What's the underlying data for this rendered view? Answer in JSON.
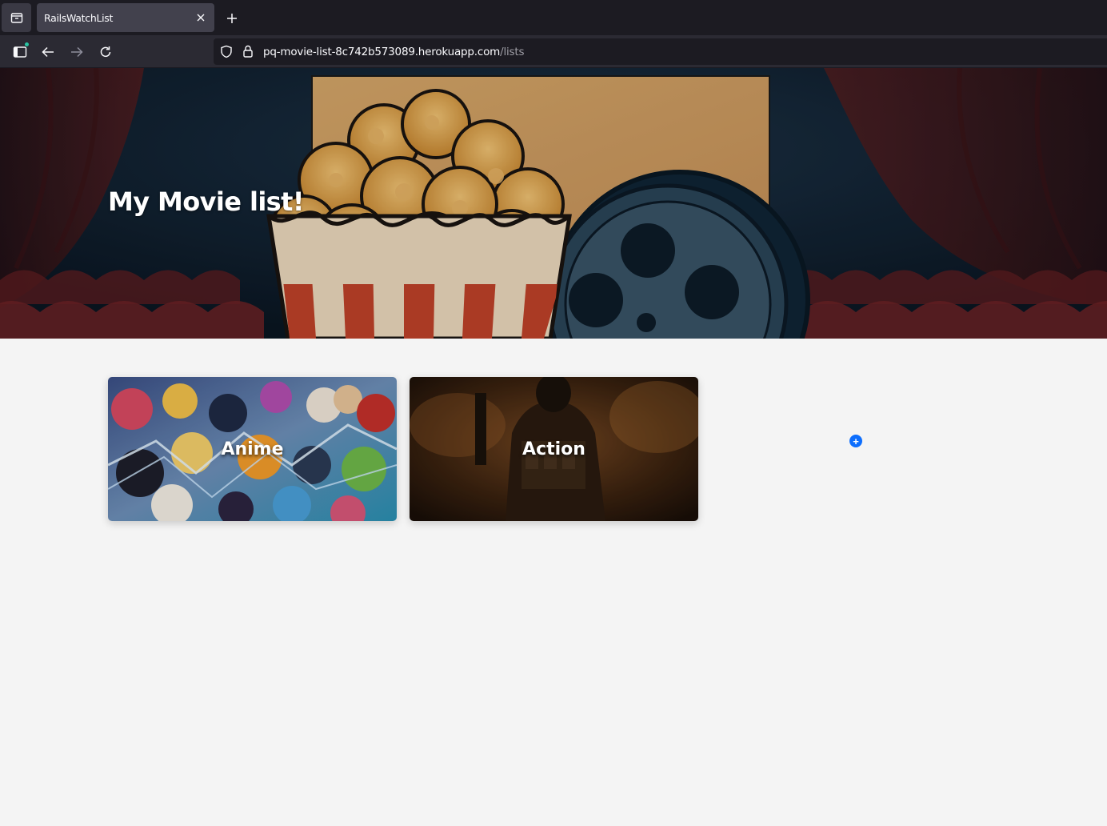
{
  "browser": {
    "tab_title": "RailsWatchList",
    "url_host": "pq-movie-list-8c742b573089.herokuapp.com",
    "url_path": "/lists",
    "icons": [
      "tab-overview-icon",
      "close-icon",
      "plus-icon",
      "sidebar-icon",
      "back-arrow-icon",
      "forward-arrow-icon",
      "reload-icon",
      "shield-icon",
      "lock-icon"
    ]
  },
  "hero": {
    "title": "My Movie list!",
    "illustration": [
      "popcorn-bucket",
      "film-reel",
      "cinema-screen",
      "curtains",
      "theater-seats"
    ]
  },
  "lists": [
    {
      "name": "Anime"
    },
    {
      "name": "Action"
    }
  ],
  "add_list": {
    "icon": "plus-icon",
    "label": "+"
  },
  "colors": {
    "hero_bg": "#0e1d2d",
    "page_bg": "#f4f4f4",
    "accent": "#0d6efd"
  }
}
